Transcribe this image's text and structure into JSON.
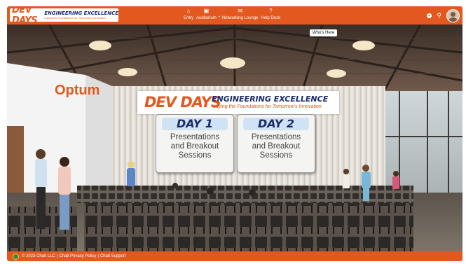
{
  "logo": {
    "dev_days": "DEV DAYS",
    "engineering_excellence": "ENGINEERING EXCELLENCE",
    "tagline": "Laying the Foundations for Tomorrow's Innovation"
  },
  "nav": {
    "items": [
      {
        "label": "Entry",
        "icon": "home-icon"
      },
      {
        "label": "Auditorium",
        "icon": "auditorium-icon"
      },
      {
        "label": "Networking Lounge",
        "icon": "chat-icon"
      },
      {
        "label": "Help Desk",
        "icon": "help-icon"
      }
    ],
    "separator": "•"
  },
  "header_right": {
    "icons": [
      "status-dot-icon",
      "search-icon",
      "user-avatar-icon"
    ]
  },
  "scene": {
    "whos_here": "Who's Here",
    "wall_logo": "Optum",
    "banner": {
      "dev_days": "DEV DAYS",
      "engineering_excellence": "ENGINEERING EXCELLENCE",
      "tagline": "Laying the Foundations for Tomorrow's Innovation"
    },
    "days": [
      {
        "title": "DAY 1",
        "line1": "Presentations",
        "line2": "and Breakout",
        "line3": "Sessions"
      },
      {
        "title": "DAY 2",
        "line1": "Presentations",
        "line2": "and Breakout",
        "line3": "Sessions"
      }
    ]
  },
  "footer": {
    "copyright": "© 2023 Chati LLC",
    "sep": "|",
    "privacy": "Chati Privacy Policy",
    "support": "Chati Support"
  },
  "colors": {
    "brand_orange": "#e2581f",
    "brand_navy": "#1b2a6b",
    "day_header_blue": "#cfe3f4"
  }
}
